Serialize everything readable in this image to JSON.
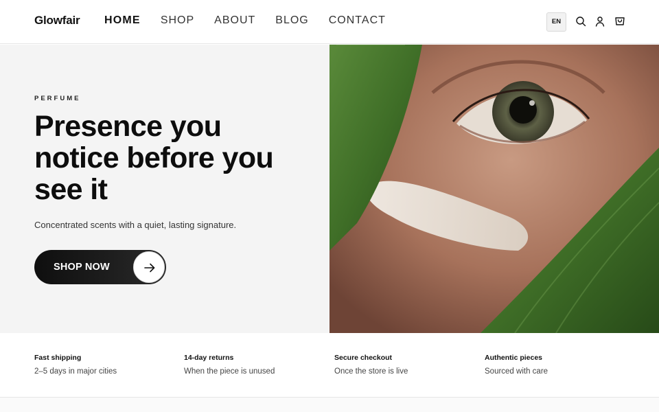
{
  "brand": {
    "name": "Glowfair"
  },
  "nav": {
    "items": [
      {
        "label": "HOME",
        "active": true
      },
      {
        "label": "SHOP",
        "active": false
      },
      {
        "label": "ABOUT",
        "active": false
      },
      {
        "label": "BLOG",
        "active": false
      },
      {
        "label": "CONTACT",
        "active": false
      }
    ]
  },
  "header_actions": {
    "language": "EN",
    "icons": [
      "search-icon",
      "account-icon",
      "cart-icon"
    ]
  },
  "hero": {
    "eyebrow": "PERFUME",
    "headline": "Presence you notice before you see it",
    "subtext": "Concentrated scents with a quiet, lasting signature.",
    "cta_label": "SHOP NOW",
    "cta_icon": "arrow-right-icon"
  },
  "features": [
    {
      "title": "Fast shipping",
      "desc": "2–5 days in major cities"
    },
    {
      "title": "14-day returns",
      "desc": "When the piece is unused"
    },
    {
      "title": "Secure checkout",
      "desc": "Once the store is live"
    },
    {
      "title": "Authentic pieces",
      "desc": "Sourced with care"
    }
  ],
  "colors": {
    "hero_bg": "#f4f4f4",
    "button_dark": "#111111",
    "text_primary": "#0d0d0d"
  }
}
